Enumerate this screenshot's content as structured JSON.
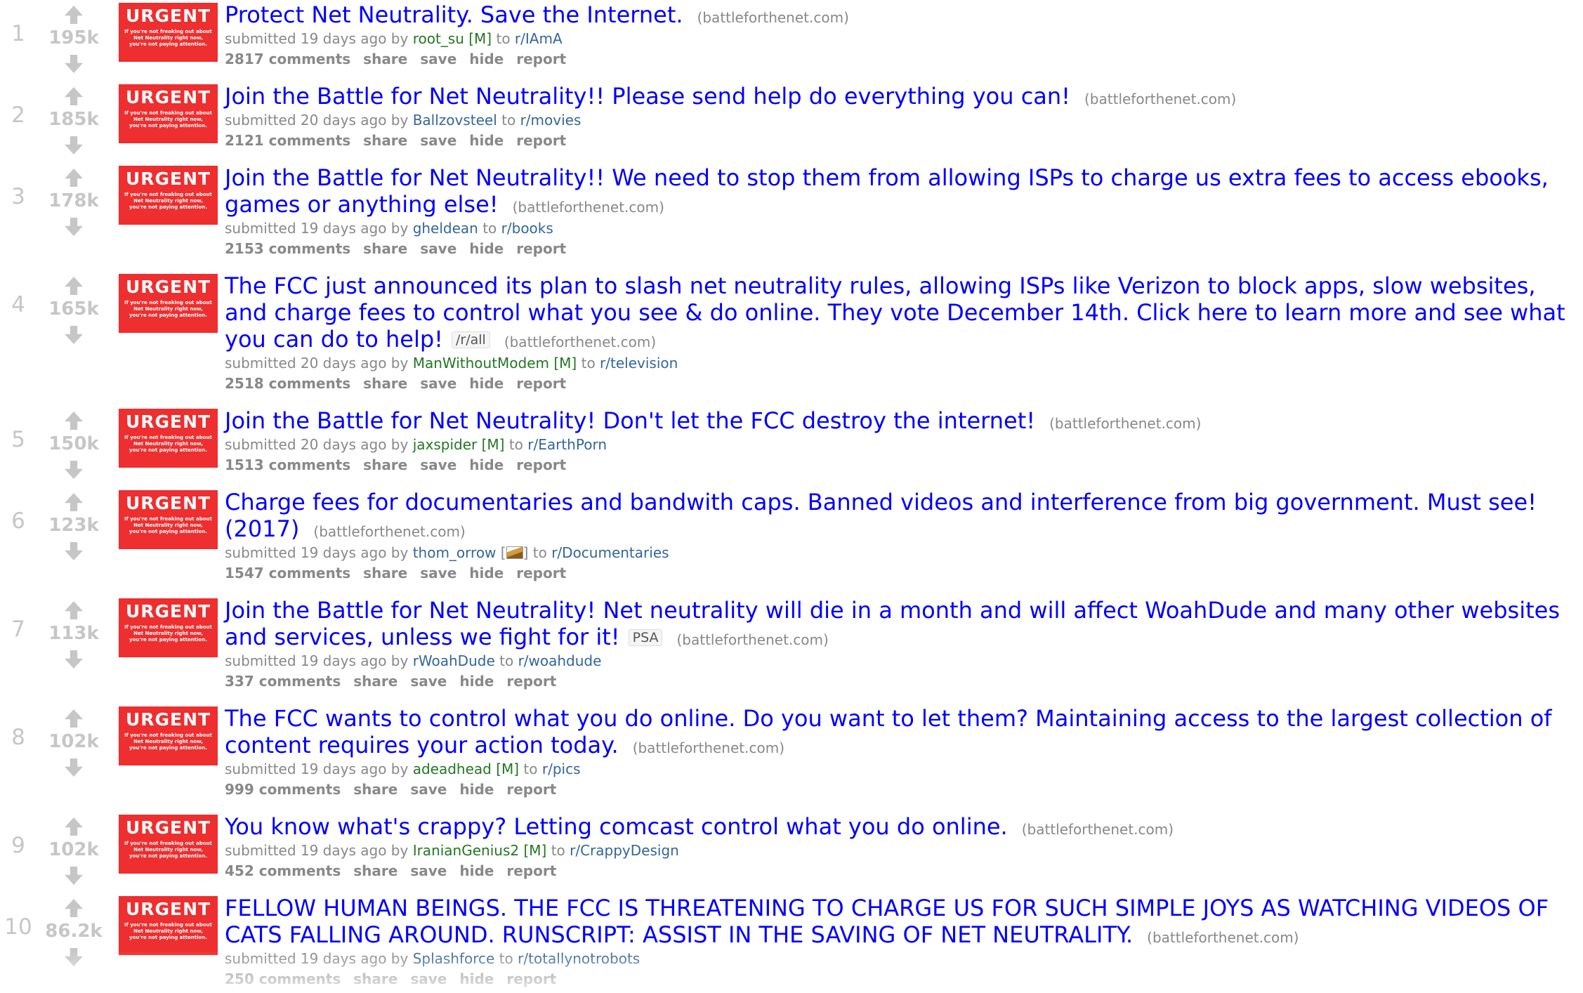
{
  "thumbnail": {
    "title": "URGENT",
    "subtitle": "If you're not freaking out about\nNet Neutrality right now,\nyou're not paying attention."
  },
  "tagline_words": {
    "submitted": "submitted",
    "by": "by",
    "to": "to"
  },
  "posts": [
    {
      "rank": "1",
      "score": "195k",
      "title": "Protect Net Neutrality. Save the Internet.",
      "flair": "",
      "domain": "(battleforthenet.com)",
      "age": "19 days ago",
      "author": "root_su",
      "author_tag": "[M]",
      "subreddit": "r/IAmA",
      "comments": "2817 comments",
      "share": "share",
      "save": "save",
      "hide": "hide",
      "report": "report"
    },
    {
      "rank": "2",
      "score": "185k",
      "title": "Join the Battle for Net Neutrality!! Please send help do everything you can!",
      "flair": "",
      "domain": "(battleforthenet.com)",
      "age": "20 days ago",
      "author": "Ballzovsteel",
      "author_tag": "",
      "subreddit": "r/movies",
      "comments": "2121 comments",
      "share": "share",
      "save": "save",
      "hide": "hide",
      "report": "report"
    },
    {
      "rank": "3",
      "score": "178k",
      "title": "Join the Battle for Net Neutrality!! We need to stop them from allowing ISPs to charge us extra fees to access ebooks, games or anything else!",
      "flair": "",
      "domain": "(battleforthenet.com)",
      "age": "19 days ago",
      "author": "gheldean",
      "author_tag": "",
      "subreddit": "r/books",
      "comments": "2153 comments",
      "share": "share",
      "save": "save",
      "hide": "hide",
      "report": "report"
    },
    {
      "rank": "4",
      "score": "165k",
      "title": "The FCC just announced its plan to slash net neutrality rules, allowing ISPs like Verizon to block apps, slow websites, and charge fees to control what you see & do online. They vote December 14th. Click here to learn more and see what you can do to help!",
      "flair": "/r/all",
      "domain": "(battleforthenet.com)",
      "age": "20 days ago",
      "author": "ManWithoutModem",
      "author_tag": "[M]",
      "subreddit": "r/television",
      "comments": "2518 comments",
      "share": "share",
      "save": "save",
      "hide": "hide",
      "report": "report"
    },
    {
      "rank": "5",
      "score": "150k",
      "title": "Join the Battle for Net Neutrality! Don't let the FCC destroy the internet!",
      "flair": "",
      "domain": "(battleforthenet.com)",
      "age": "20 days ago",
      "author": "jaxspider",
      "author_tag": "[M]",
      "subreddit": "r/EarthPorn",
      "comments": "1513 comments",
      "share": "share",
      "save": "save",
      "hide": "hide",
      "report": "report"
    },
    {
      "rank": "6",
      "score": "123k",
      "title": "Charge fees for documentaries and bandwith caps. Banned videos and interference from big government. Must see! (2017)",
      "flair": "",
      "domain": "(battleforthenet.com)",
      "age": "19 days ago",
      "author": "thom_orrow",
      "author_tag": "",
      "subreddit": "r/Documentaries",
      "comments": "1547 comments",
      "share": "share",
      "save": "save",
      "hide": "hide",
      "report": "report"
    },
    {
      "rank": "7",
      "score": "113k",
      "title": "Join the Battle for Net Neutrality! Net neutrality will die in a month and will affect WoahDude and many other websites and services, unless we fight for it!",
      "flair": "PSA",
      "domain": "(battleforthenet.com)",
      "age": "19 days ago",
      "author": "rWoahDude",
      "author_tag": "",
      "subreddit": "r/woahdude",
      "comments": "337 comments",
      "share": "share",
      "save": "save",
      "hide": "hide",
      "report": "report"
    },
    {
      "rank": "8",
      "score": "102k",
      "title": "The FCC wants to control what you do online. Do you want to let them? Maintaining access to the largest collection of content requires your action today.",
      "flair": "",
      "domain": "(battleforthenet.com)",
      "age": "19 days ago",
      "author": "adeadhead",
      "author_tag": "[M]",
      "subreddit": "r/pics",
      "comments": "999 comments",
      "share": "share",
      "save": "save",
      "hide": "hide",
      "report": "report"
    },
    {
      "rank": "9",
      "score": "102k",
      "title": "You know what's crappy? Letting comcast control what you do online.",
      "flair": "",
      "domain": "(battleforthenet.com)",
      "age": "19 days ago",
      "author": "IranianGenius2",
      "author_tag": "[M]",
      "subreddit": "r/CrappyDesign",
      "comments": "452 comments",
      "share": "share",
      "save": "save",
      "hide": "hide",
      "report": "report"
    },
    {
      "rank": "10",
      "score": "86.2k",
      "title": "FELLOW HUMAN BEINGS. THE FCC IS THREATENING TO CHARGE US FOR SUCH SIMPLE JOYS AS WATCHING VIDEOS OF CATS FALLING AROUND. RUNSCRIPT: ASSIST IN THE SAVING OF NET NEUTRALITY.",
      "flair": "",
      "domain": "(battleforthenet.com)",
      "age": "19 days ago",
      "author": "Splashforce",
      "author_tag": "",
      "subreddit": "r/totallynotrobots",
      "comments": "250 comments",
      "share": "share",
      "save": "save",
      "hide": "hide",
      "report": "report"
    }
  ]
}
